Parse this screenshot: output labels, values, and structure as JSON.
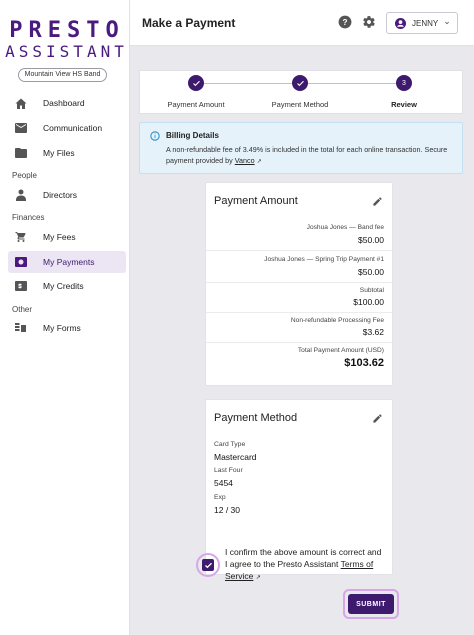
{
  "brand": {
    "line1": "PRESTO",
    "line2": "ASSISTANT"
  },
  "org": {
    "name": "Mountain View HS Band"
  },
  "nav": {
    "dashboard": "Dashboard",
    "communication": "Communication",
    "files": "My Files",
    "people_section": "People",
    "directors": "Directors",
    "finances_section": "Finances",
    "fees": "My Fees",
    "payments": "My Payments",
    "credits": "My Credits",
    "other_section": "Other",
    "forms": "My Forms"
  },
  "header": {
    "title": "Make a Payment",
    "user": "JENNY"
  },
  "stepper": {
    "steps": [
      {
        "label": "Payment Amount",
        "state": "done"
      },
      {
        "label": "Payment Method",
        "state": "done"
      },
      {
        "label": "Review",
        "number": "3",
        "state": "active"
      }
    ]
  },
  "billing": {
    "title": "Billing Details",
    "text": "A non-refundable fee of 3.49% is included in the total for each online transaction. Secure payment provided by",
    "link": "Vanco"
  },
  "payment_amount": {
    "title": "Payment Amount",
    "items": [
      {
        "label": "Joshua Jones — Band fee",
        "value": "$50.00"
      },
      {
        "label": "Joshua Jones — Spring Trip Payment #1",
        "value": "$50.00"
      }
    ],
    "subtotal_label": "Subtotal",
    "subtotal": "$100.00",
    "fee_label": "Non-refundable Processing Fee",
    "fee": "$3.62",
    "total_label": "Total Payment Amount (USD)",
    "total": "$103.62"
  },
  "payment_method": {
    "title": "Payment Method",
    "card_type_label": "Card Type",
    "card_type": "Mastercard",
    "last_four_label": "Last Four",
    "last_four": "5454",
    "exp_label": "Exp",
    "exp": "12 / 30"
  },
  "confirm": {
    "text": "I confirm the above amount is correct and I agree to the Presto Assistant",
    "link": "Terms of Service",
    "checked": true
  },
  "submit": {
    "label": "SUBMIT"
  },
  "colors": {
    "brand": "#3d1a6e",
    "info_bg": "#e5f2fa",
    "highlight": "#d7a6e8"
  }
}
